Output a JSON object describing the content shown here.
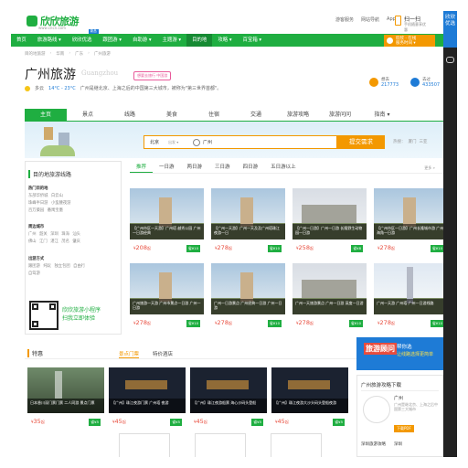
{
  "header": {
    "logo_text": "欣欣旅游",
    "logo_sub": "www.cncn.com",
    "links": [
      "游客服务",
      "网站导航",
      "App"
    ],
    "scan_title": "扫一扫",
    "scan_sub": "手机随意享优惠"
  },
  "nav": {
    "items": [
      "首页",
      "旅游路线 ▾",
      "欣欣优选",
      "跟团游 ▾",
      "自助游 ▾",
      "主题游 ▾",
      "目的地",
      "攻略 ▾",
      "百宝箱 ▾"
    ],
    "active_index": 6,
    "badge": "新品",
    "service_line1": "欣欣 · 在线",
    "service_line2": "服务时间 ▾"
  },
  "breadcrumb": [
    "目的地旅游",
    "华南",
    "广东",
    "广州旅游"
  ],
  "title": {
    "name": "广州旅游",
    "pinyin": "Guangzhou",
    "tag": "想要去旅行 中国游",
    "weather_day": "多云",
    "weather_temp": "14°C - 23°C",
    "intro": "广州是继北京、上海之后的中国第三大城市，被称为\"第三世界首都\"。"
  },
  "stats": [
    {
      "label": "想去",
      "value": "217773",
      "color": "#f39800"
    },
    {
      "label": "去过",
      "value": "433507",
      "color": "#1e7bd6"
    }
  ],
  "tabs": [
    "主页",
    "景点",
    "线路",
    "美食",
    "住宿",
    "交通",
    "旅游攻略",
    "旅游问问",
    "指南 ▾"
  ],
  "search": {
    "city": "北京",
    "city_dd": "出发 ▾",
    "value": "广州",
    "button": "提交需求",
    "hot_label": "热搜：",
    "hot": [
      "厦门",
      "三亚"
    ]
  },
  "sidebar": {
    "heading": "目的地旅游线路",
    "groups": [
      {
        "title": "热门目的地",
        "rows": [
          [
            "东部华侨城",
            "白云山"
          ],
          [
            "珠峰半日游",
            "小蛮腰夜游"
          ],
          [
            "百万葵园",
            "番禺宝墨"
          ]
        ]
      },
      {
        "title": "周边城市",
        "rows": [
          [
            "广州",
            "韶关",
            "深圳",
            "珠海",
            "汕头"
          ],
          [
            "佛山",
            "江门",
            "湛江",
            "茂名",
            "肇庆"
          ]
        ]
      },
      {
        "title": "出游方式",
        "rows": [
          [
            "跟团游",
            "纯玩",
            "独立包团",
            "自由行"
          ],
          [
            "自驾游"
          ]
        ]
      }
    ],
    "mini_title": "欣欣旅游小程序",
    "mini_sub": "扫我立即体验"
  },
  "routes": {
    "tabs": [
      "推荐",
      "一日游",
      "两日游",
      "三日游",
      "四日游",
      "五日游以上"
    ],
    "more": "更多 »",
    "cards": [
      {
        "desc": "【广州市区一天游】广州塔 越秀公园 广州一日游经典",
        "price": "208",
        "badge": "省¥10",
        "style": "a"
      },
      {
        "desc": "【广州一天游】广州一天及及广州塔珠江夜游一日",
        "price": "278",
        "badge": "省¥10",
        "style": "a"
      },
      {
        "desc": "【广州一日游】广州一日游 长隆野生动物园一日游",
        "price": "258",
        "badge": "省¥8",
        "style": "b"
      },
      {
        "desc": "【广州市区一日游】广州长隆城市游 广州海角一日游",
        "price": "278",
        "badge": "省¥10",
        "style": "a"
      },
      {
        "desc": "广州旅游一天游 广州市景点一日游 广州一日游",
        "price": "278",
        "badge": "省¥10",
        "style": "a"
      },
      {
        "desc": "广州一日游景点 广州经典一日游 广州一日游",
        "price": "278",
        "badge": "省¥10",
        "style": "a"
      },
      {
        "desc": "广州一天旅游景点 广州一日游 深度一日游",
        "price": "278",
        "badge": "省¥10",
        "style": "b"
      },
      {
        "desc": "广州一天游 广州塔 广州一日游线路",
        "price": "278",
        "badge": "省¥10",
        "style": "c"
      }
    ]
  },
  "special": {
    "heading": "特惠",
    "tab1": "景点门票",
    "tab2": "特价酒店",
    "cards": [
      {
        "desc": "日本香川深门票门票 二人同游 景点门票",
        "price": "35",
        "badge": "省¥5",
        "style": "f"
      },
      {
        "desc": "【广州】珠江夜游门票 广州塔 夜游",
        "price": "45",
        "badge": "省¥5",
        "style": "n"
      },
      {
        "desc": "【广州】珠江夜游船票 海心沙码头登船",
        "price": "45",
        "badge": "省¥5",
        "style": "n"
      },
      {
        "desc": "【广州】珠江夜游大沙头码头登船夜游",
        "price": "45",
        "badge": "省¥5",
        "style": "n"
      }
    ]
  },
  "right": {
    "banner_t": "旅游顾问",
    "banner_t2": "帮你选",
    "banner_t3": "让线路选择更简单",
    "box_title": "广州旅游攻略下载",
    "city": "广州",
    "city_desc": "广州是继北京、上海之后中国第三大城市",
    "download": "下载PDF",
    "c2": "深圳旅游攻略",
    "c2b": "深圳"
  },
  "float": {
    "label": "欣欣优选"
  }
}
